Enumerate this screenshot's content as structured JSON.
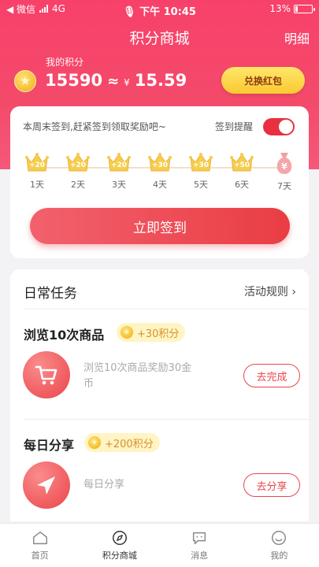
{
  "status_bar": {
    "back_label": "◀ 微信",
    "network": "4G",
    "time": "下午 10:45",
    "battery": "13%"
  },
  "nav": {
    "title": "积分商城",
    "right_link": "明细"
  },
  "points": {
    "label": "我的积分",
    "value": "15590",
    "approx": "≈",
    "yen": "¥",
    "money": "15.59",
    "exchange_button": "兑换红包"
  },
  "signin": {
    "tip": "本周末签到,赶紧签到领取奖励吧~",
    "remind_label": "签到提醒",
    "remind_on": true,
    "days": [
      {
        "reward": "+20",
        "label": "1天"
      },
      {
        "reward": "+20",
        "label": "2天"
      },
      {
        "reward": "+20",
        "label": "3天"
      },
      {
        "reward": "+30",
        "label": "4天"
      },
      {
        "reward": "+30",
        "label": "5天"
      },
      {
        "reward": "+50",
        "label": "6天"
      },
      {
        "reward": "¥",
        "label": "7天"
      }
    ],
    "button": "立即签到"
  },
  "tasks": {
    "title": "日常任务",
    "rules_link": "活动规则 ›",
    "items": [
      {
        "name": "浏览10次商品",
        "reward": "+30积分",
        "icon": "cart-icon",
        "desc_line1": "浏览10次商品奖励30金",
        "desc_line2": "币",
        "button": "去完成"
      },
      {
        "name": "每日分享",
        "reward": "+200积分",
        "icon": "share-icon",
        "desc_line1": "每日分享",
        "desc_line2": "",
        "button": "去分享"
      }
    ]
  },
  "tabbar": {
    "items": [
      {
        "label": "首页",
        "icon": "home-icon"
      },
      {
        "label": "积分商城",
        "icon": "compass-icon"
      },
      {
        "label": "消息",
        "icon": "message-icon"
      },
      {
        "label": "我的",
        "icon": "profile-icon"
      }
    ],
    "active_index": 1
  },
  "colors": {
    "header": "#f7416a",
    "accent": "#e8474c",
    "gold": "#fbc931"
  }
}
